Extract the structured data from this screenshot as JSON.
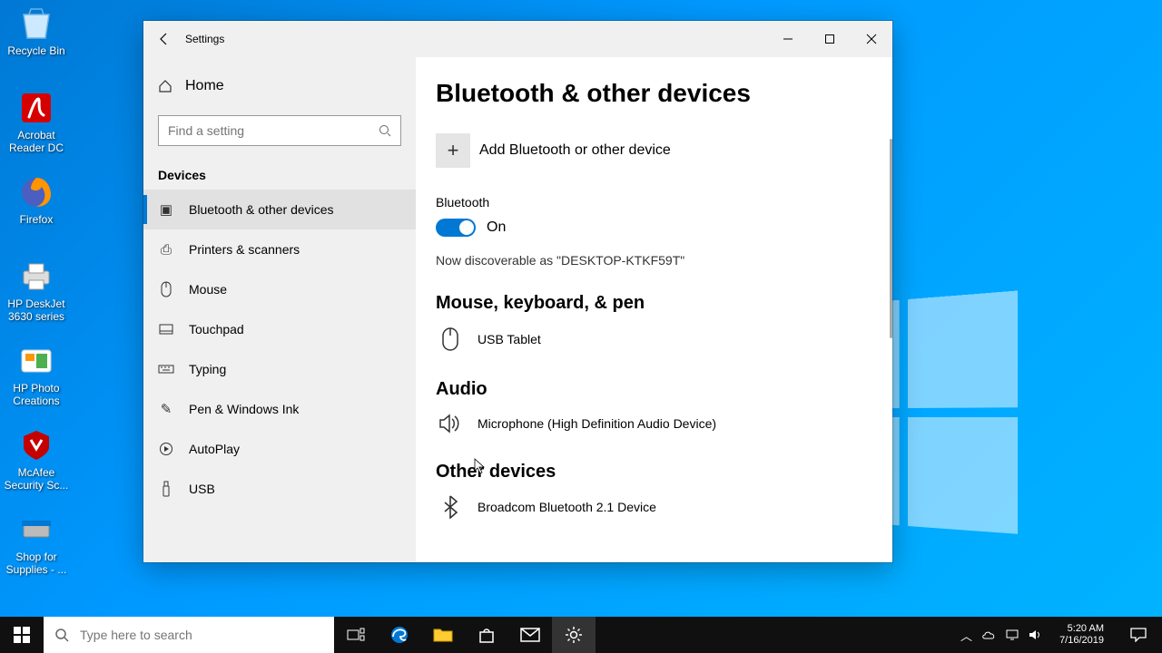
{
  "desktop_icons": [
    {
      "label": "Recycle Bin"
    },
    {
      "label": "Acrobat Reader DC"
    },
    {
      "label": "Firefox"
    },
    {
      "label": "HP DeskJet 3630 series"
    },
    {
      "label": "HP Photo Creations"
    },
    {
      "label": "McAfee Security Sc..."
    },
    {
      "label": "Shop for Supplies - ..."
    }
  ],
  "settings": {
    "window_title": "Settings",
    "home": "Home",
    "search_placeholder": "Find a setting",
    "section_title": "Devices",
    "nav": [
      {
        "label": "Bluetooth & other devices",
        "active": true
      },
      {
        "label": "Printers & scanners"
      },
      {
        "label": "Mouse"
      },
      {
        "label": "Touchpad"
      },
      {
        "label": "Typing"
      },
      {
        "label": "Pen & Windows Ink"
      },
      {
        "label": "AutoPlay"
      },
      {
        "label": "USB"
      }
    ],
    "page_title": "Bluetooth & other devices",
    "add_label": "Add Bluetooth or other device",
    "bt_label": "Bluetooth",
    "bt_state": "On",
    "discoverable": "Now discoverable as \"DESKTOP-KTKF59T\"",
    "group_mouse": "Mouse, keyboard, & pen",
    "device_mouse": "USB Tablet",
    "group_audio": "Audio",
    "device_audio": "Microphone (High Definition Audio Device)",
    "group_other": "Other devices",
    "device_other": "Broadcom Bluetooth 2.1 Device"
  },
  "taskbar": {
    "search_placeholder": "Type here to search",
    "time": "5:20 AM",
    "date": "7/16/2019"
  }
}
